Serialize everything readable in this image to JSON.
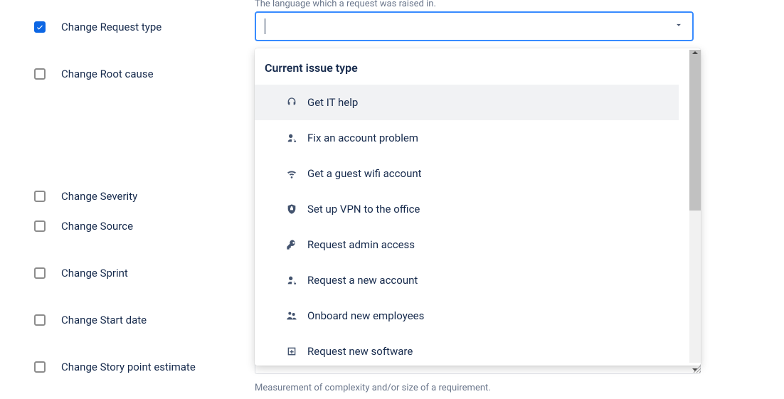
{
  "left": {
    "items": [
      {
        "label": "Change Request type",
        "checked": true
      },
      {
        "label": "Change Root cause",
        "checked": false
      },
      {
        "label": "Change Severity",
        "checked": false
      },
      {
        "label": "Change Source",
        "checked": false
      },
      {
        "label": "Change Sprint",
        "checked": false
      },
      {
        "label": "Change Start date",
        "checked": false
      },
      {
        "label": "Change Story point estimate",
        "checked": false
      }
    ]
  },
  "field": {
    "top_hint": "The language which a request was raised in."
  },
  "dropdown": {
    "header": "Current issue type",
    "items": [
      {
        "icon": "headset-icon",
        "label": "Get IT help"
      },
      {
        "icon": "person-gear-icon",
        "label": "Fix an account problem"
      },
      {
        "icon": "wifi-icon",
        "label": "Get a guest wifi account"
      },
      {
        "icon": "shield-icon",
        "label": "Set up VPN to the office"
      },
      {
        "icon": "key-icon",
        "label": "Request admin access"
      },
      {
        "icon": "person-gear-icon",
        "label": "Request a new account"
      },
      {
        "icon": "people-icon",
        "label": "Onboard new employees"
      },
      {
        "icon": "add-app-icon",
        "label": "Request new software"
      }
    ]
  },
  "bottom_hint": "Measurement of complexity and/or size of a requirement."
}
